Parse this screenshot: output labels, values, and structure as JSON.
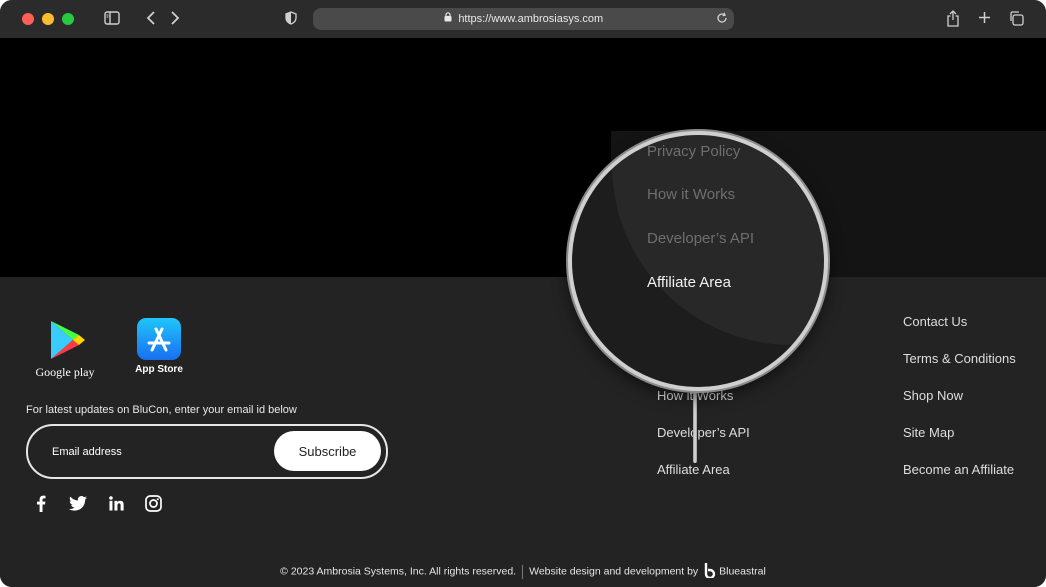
{
  "browser": {
    "url": "https://www.ambrosiasys.com"
  },
  "stores": {
    "google_label": "Google play",
    "apple_label": "App Store"
  },
  "newsletter": {
    "prompt": "For latest updates on BluCon, enter your email id below",
    "email_placeholder": "Email address",
    "subscribe_label": "Subscribe"
  },
  "links_col1": [
    "How it Works",
    "Developer’s API",
    "Affiliate Area"
  ],
  "links_col2": [
    "Contact Us",
    "Terms & Conditions",
    "Shop Now",
    "Site Map",
    "Become an Affiliate"
  ],
  "magnifier": {
    "items": [
      "Privacy Policy",
      "How it Works",
      "Developer’s API",
      "Affiliate Area"
    ]
  },
  "footer": {
    "copyright": "© 2023 Ambrosia Systems, Inc. All rights reserved.",
    "credit": "Website design and development by",
    "credit_brand": "Blueastral"
  },
  "colors": {
    "footer_bg": "#232323",
    "hero_bg": "#000000"
  }
}
